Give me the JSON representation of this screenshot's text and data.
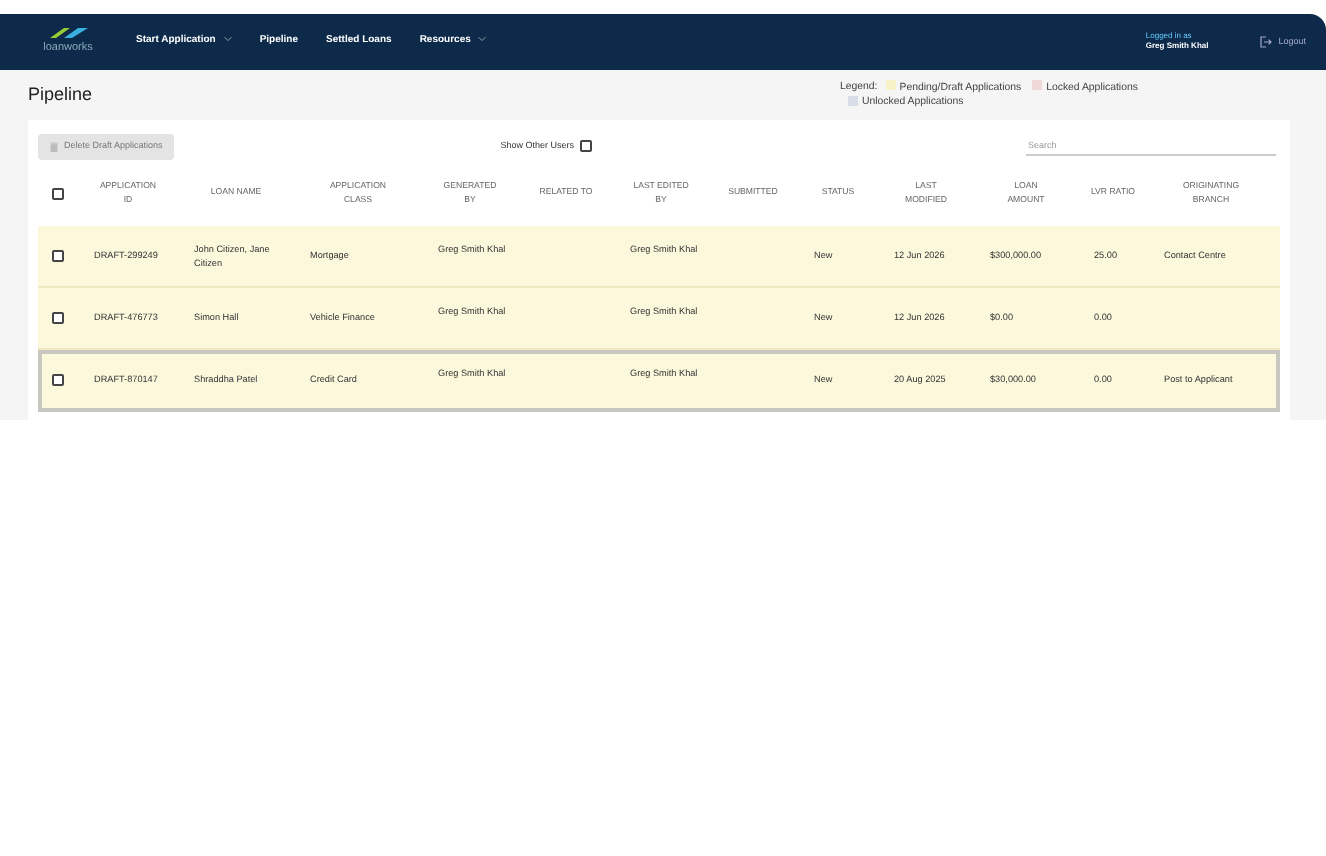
{
  "navbar": {
    "logo": "loanworks",
    "items": [
      {
        "label": "Start Application",
        "dropdown": true
      },
      {
        "label": "Pipeline",
        "dropdown": false
      },
      {
        "label": "Settled Loans",
        "dropdown": false
      },
      {
        "label": "Resources",
        "dropdown": true
      }
    ],
    "user_caption": "Logged in as",
    "user_name": "Greg Smith Khal",
    "logout": "Logout"
  },
  "page_title": "Pipeline",
  "legend": {
    "label": "Legend:",
    "items": [
      {
        "label": "Pending/Draft Applications",
        "color": "#f8f2c8"
      },
      {
        "label": "Locked Applications",
        "color": "#f0d8d8"
      },
      {
        "label": "Unlocked Applications",
        "color": "#d8dde8"
      }
    ]
  },
  "toolbar": {
    "delete_button": {
      "label": "Delete Draft Applications",
      "disabled": true
    },
    "show_other_users": {
      "label": "Show Other Users",
      "checked": false
    },
    "search": {
      "placeholder": "Search"
    }
  },
  "table": {
    "select_all_checked": false,
    "columns": [
      "APPLICATION ID",
      "LOAN NAME",
      "APPLICATION CLASS",
      "GENERATED BY",
      "RELATED TO",
      "LAST EDITED BY",
      "SUBMITTED",
      "STATUS",
      "LAST MODIFIED",
      "LOAN AMOUNT",
      "LVR RATIO",
      "ORIGINATING BRANCH"
    ],
    "rows": [
      {
        "checked": false,
        "selected": false,
        "cells": [
          "DRAFT-299249",
          "John Citizen, Jane Citizen",
          "Mortgage",
          "Greg Smith Khal",
          "",
          "Greg Smith Khal",
          "",
          "New",
          "12 Jun 2026",
          "$300,000.00",
          "25.00",
          "Contact Centre"
        ]
      },
      {
        "checked": false,
        "selected": false,
        "cells": [
          "DRAFT-476773",
          "Simon Hall",
          "Vehicle Finance",
          "Greg Smith Khal",
          "",
          "Greg Smith Khal",
          "",
          "New",
          "12 Jun 2026",
          "$0.00",
          "0.00",
          ""
        ]
      },
      {
        "checked": false,
        "selected": true,
        "cells": [
          "DRAFT-870147",
          "Shraddha Patel",
          "Credit Card",
          "Greg Smith Khal",
          "",
          "Greg Smith Khal",
          "",
          "New",
          "20 Aug 2025",
          "$30,000.00",
          "0.00",
          "Post to Applicant"
        ]
      }
    ]
  }
}
